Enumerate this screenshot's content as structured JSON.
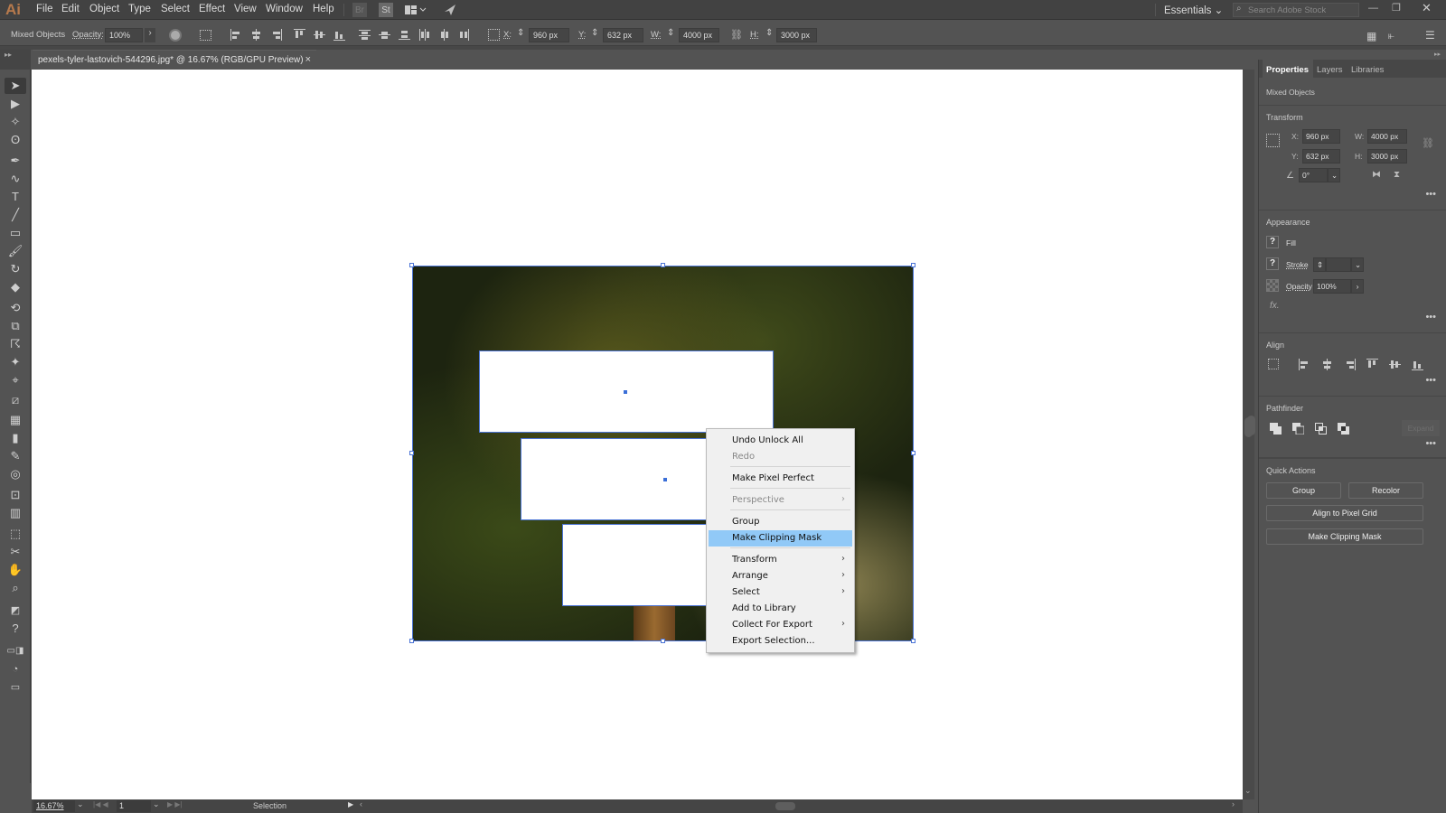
{
  "app": {
    "logo": "Ai"
  },
  "menubar": {
    "items": [
      "File",
      "Edit",
      "Object",
      "Type",
      "Select",
      "Effect",
      "View",
      "Window",
      "Help"
    ],
    "icons": [
      "bridge-icon",
      "stock-icon",
      "arrange-documents-icon",
      "gpu-performance-icon"
    ],
    "bridge_label": "Br",
    "stock_label": "St",
    "workspace": "Essentials",
    "search_placeholder": "Search Adobe Stock"
  },
  "controlbar": {
    "selection_type": "Mixed Objects",
    "opacity_label": "Opacity:",
    "opacity_value": "100%",
    "x_label": "X:",
    "x_value": "960 px",
    "y_label": "Y:",
    "y_value": "632 px",
    "w_label": "W:",
    "w_value": "4000 px",
    "h_label": "H:",
    "h_value": "3000 px"
  },
  "document": {
    "tab_title": "pexels-tyler-lastovich-544296.jpg* @ 16.67% (RGB/GPU Preview)",
    "close": "×"
  },
  "context_menu": {
    "items": [
      {
        "label": "Undo Unlock All",
        "enabled": true,
        "submenu": false
      },
      {
        "label": "Redo",
        "enabled": false,
        "submenu": false
      },
      {
        "label": "Make Pixel Perfect",
        "enabled": true,
        "submenu": false
      },
      {
        "label": "Perspective",
        "enabled": false,
        "submenu": true
      },
      {
        "label": "Group",
        "enabled": true,
        "submenu": false
      },
      {
        "label": "Make Clipping Mask",
        "enabled": true,
        "submenu": false,
        "highlighted": true
      },
      {
        "label": "Transform",
        "enabled": true,
        "submenu": true
      },
      {
        "label": "Arrange",
        "enabled": true,
        "submenu": true
      },
      {
        "label": "Select",
        "enabled": true,
        "submenu": true
      },
      {
        "label": "Add to Library",
        "enabled": true,
        "submenu": false
      },
      {
        "label": "Collect For Export",
        "enabled": true,
        "submenu": true
      },
      {
        "label": "Export Selection...",
        "enabled": true,
        "submenu": false
      }
    ],
    "arrow": "›"
  },
  "statusbar": {
    "zoom": "16.67%",
    "artboard": "1",
    "tool": "Selection"
  },
  "panel": {
    "tabs": [
      "Properties",
      "Layers",
      "Libraries"
    ],
    "active_tab": "Properties",
    "selection_type": "Mixed Objects",
    "transform": {
      "title": "Transform",
      "x_label": "X:",
      "x": "960 px",
      "y_label": "Y:",
      "y": "632 px",
      "w_label": "W:",
      "w": "4000 px",
      "h_label": "H:",
      "h": "3000 px",
      "angle": "0°"
    },
    "appearance": {
      "title": "Appearance",
      "fill_label": "Fill",
      "stroke_label": "Stroke",
      "opacity_label": "Opacity",
      "opacity_value": "100%",
      "unknown_swatch": "?",
      "fx": "fx."
    },
    "align": {
      "title": "Align"
    },
    "pathfinder": {
      "title": "Pathfinder",
      "expand_label": "Expand"
    },
    "quick_actions": {
      "title": "Quick Actions",
      "group": "Group",
      "recolor": "Recolor",
      "align_pixel": "Align to Pixel Grid",
      "clipping_mask": "Make Clipping Mask"
    },
    "more": "•••"
  }
}
